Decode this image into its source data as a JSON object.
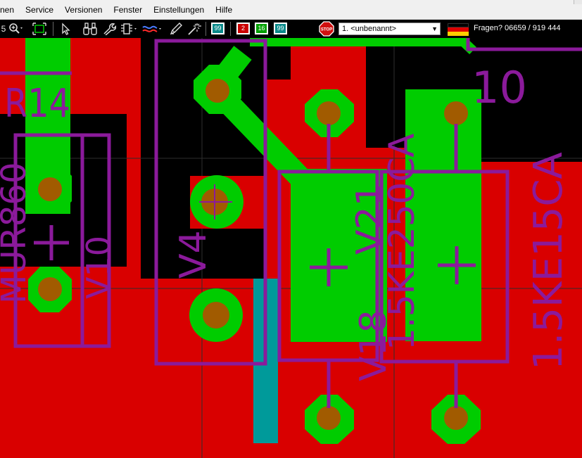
{
  "menubar": {
    "items": [
      "nen",
      "Service",
      "Versionen",
      "Fenster",
      "Einstellungen",
      "Hilfe"
    ]
  },
  "toolbar": {
    "zoom_prefix": "5",
    "icons": [
      "zoom-icon",
      "zoom-fit-icon",
      "pointer-icon",
      "binoculars-icon",
      "wrench-icon",
      "component-icon",
      "route-icon",
      "pencil-icon",
      "magic-wand-icon"
    ],
    "layer_badge_1": "99",
    "layer_badge_2": "2",
    "layer_badge_3": "16",
    "layer_badge_4": "99",
    "sheet_select": "1. <unbenannt>",
    "help_text": "Fragen? 06659 / 919 444"
  },
  "colors": {
    "board_red": "#d90000",
    "copper_green": "#00cc00",
    "drill_brown": "#a15b00",
    "silkscreen_purple": "#8b1a9b",
    "teal_track": "#009a9a",
    "background": "#000000"
  },
  "canvas": {
    "labels": {
      "r14": "R14",
      "mur": "MUR860",
      "v10": "V10",
      "v4": "V4",
      "label_10": "10",
      "v21": "V21",
      "v18": "V18",
      "ke250": "1.5KE250CA",
      "ke15": "1.5KE15CA",
      "plus_1": "+",
      "plus_2": "+",
      "plus_3": "+"
    }
  }
}
